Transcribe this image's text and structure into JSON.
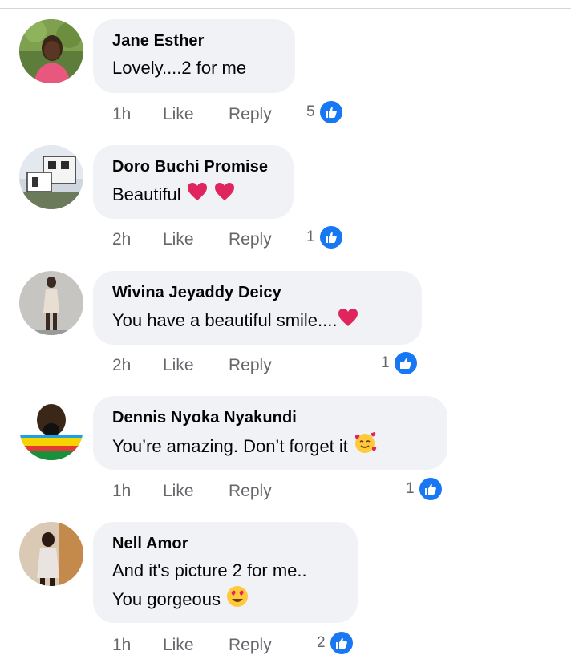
{
  "comments": [
    {
      "name": "Jane Esther",
      "lines": [
        "Lovely....2 for me"
      ],
      "time": "1h",
      "like_label": "Like",
      "reply_label": "Reply",
      "reaction_count": "5",
      "reaction_icon": "thumbs-up-icon",
      "emojis": []
    },
    {
      "name": "Doro Buchi Promise",
      "lines": [
        "Beautiful"
      ],
      "time": "2h",
      "like_label": "Like",
      "reply_label": "Reply",
      "reaction_count": "1",
      "reaction_icon": "thumbs-up-icon",
      "emojis": [
        "red-heart",
        "red-heart"
      ]
    },
    {
      "name": "Wivina Jeyaddy Deicy",
      "lines": [
        "You have a beautiful smile...."
      ],
      "time": "2h",
      "like_label": "Like",
      "reply_label": "Reply",
      "reaction_count": "1",
      "reaction_icon": "thumbs-up-icon",
      "emojis": [
        "red-heart"
      ]
    },
    {
      "name": "Dennis Nyoka Nyakundi",
      "lines": [
        "You’re amazing. Don’t forget it"
      ],
      "time": "1h",
      "like_label": "Like",
      "reply_label": "Reply",
      "reaction_count": "1",
      "reaction_icon": "thumbs-up-icon",
      "emojis": [
        "smiling-face-with-hearts"
      ]
    },
    {
      "name": "Nell Amor",
      "lines": [
        "And it's picture 2 for me..",
        "You gorgeous"
      ],
      "time": "1h",
      "like_label": "Like",
      "reply_label": "Reply",
      "reaction_count": "2",
      "reaction_icon": "thumbs-up-icon",
      "emojis": [
        "smiling-face-with-heart-eyes"
      ]
    }
  ],
  "colors": {
    "bubble": "#f0f2f5",
    "meta_text": "#65676b",
    "like_badge": "#1877f2",
    "heart": "#e0245e"
  }
}
